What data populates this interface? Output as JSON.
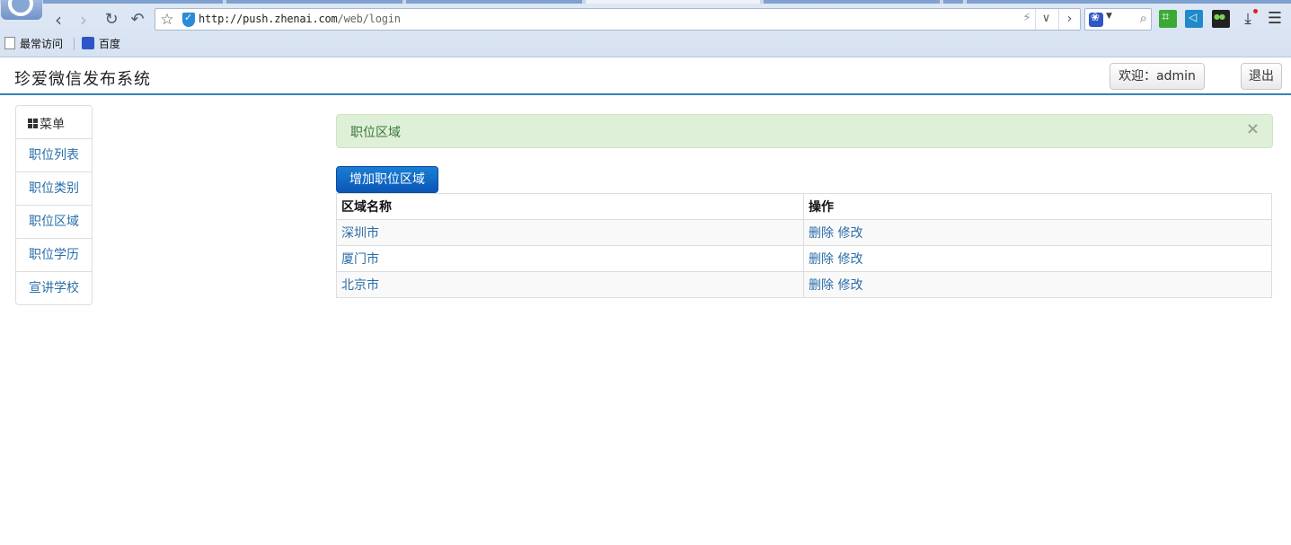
{
  "browser": {
    "url_host": "http://push.zhenai.com",
    "url_path": "/web/login",
    "bookmarks": [
      {
        "label": "最常访问"
      },
      {
        "label": "百度"
      }
    ]
  },
  "header": {
    "brand": "珍爱微信发布系统",
    "welcome_label": "欢迎：admin",
    "logout_label": "退出"
  },
  "sidebar": {
    "title": "菜单",
    "items": [
      {
        "label": "职位列表"
      },
      {
        "label": "职位类别"
      },
      {
        "label": "职位区域"
      },
      {
        "label": "职位学历"
      },
      {
        "label": "宣讲学校"
      }
    ]
  },
  "main": {
    "alert_text": "职位区域",
    "alert_close": "×",
    "add_button_label": "增加职位区域",
    "table": {
      "columns": [
        "区域名称",
        "操作"
      ],
      "rows": [
        {
          "name": "深圳市",
          "delete": "删除",
          "edit": "修改"
        },
        {
          "name": "厦门市",
          "delete": "删除",
          "edit": "修改"
        },
        {
          "name": "北京市",
          "delete": "删除",
          "edit": "修改"
        }
      ]
    }
  },
  "colors": {
    "accent": "#2e86b8",
    "link": "#2a6ea8",
    "alert_bg": "#dff0d8",
    "primary_button": "#0a56b8"
  }
}
